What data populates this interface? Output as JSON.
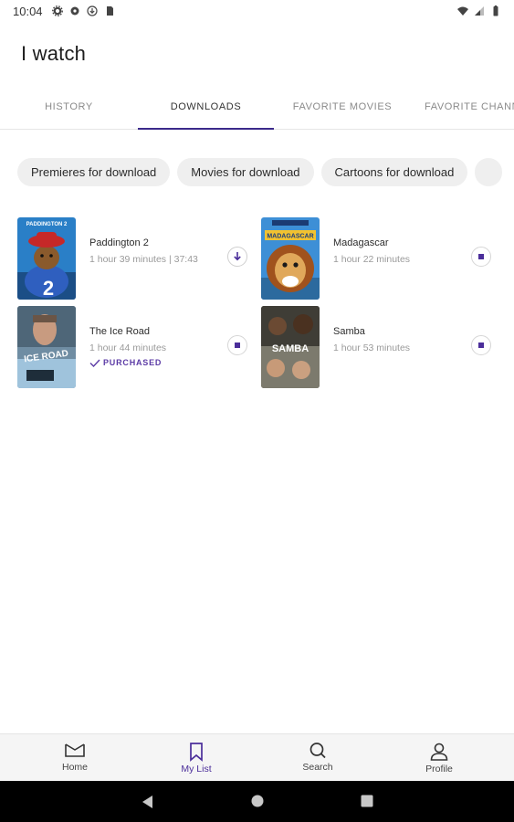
{
  "status_bar": {
    "time": "10:04",
    "left_icons": [
      "gear-icon",
      "notification-icon",
      "download-status-icon",
      "sd-card-icon"
    ],
    "right_icons": [
      "wifi-icon",
      "signal-icon",
      "battery-icon"
    ]
  },
  "app": {
    "title": "I watch"
  },
  "tabs": [
    {
      "label": "HISTORY",
      "active": false
    },
    {
      "label": "DOWNLOADS",
      "active": true
    },
    {
      "label": "FAVORITE MOVIES",
      "active": false
    },
    {
      "label": "FAVORITE CHANN",
      "active": false
    }
  ],
  "chips": [
    {
      "label": "Premieres for download"
    },
    {
      "label": "Movies for download"
    },
    {
      "label": "Cartoons for download"
    },
    {
      "label": ""
    }
  ],
  "movies": [
    {
      "title": "Paddington 2",
      "meta": "1 hour 39 minutes | 37:43",
      "badge": "",
      "action": "downloading",
      "poster_text": "PADDINGTON 2"
    },
    {
      "title": "Madagascar",
      "meta": "1 hour 22 minutes",
      "badge": "",
      "action": "stop",
      "poster_text": "MADAGASCAR"
    },
    {
      "title": "The Ice Road",
      "meta": "1 hour 44 minutes",
      "badge": "PURCHASED",
      "action": "stop",
      "poster_text": "ICE ROAD"
    },
    {
      "title": "Samba",
      "meta": "1 hour 53 minutes",
      "badge": "",
      "action": "stop",
      "poster_text": "SAMBA"
    }
  ],
  "bottom_nav": [
    {
      "label": "Home",
      "icon": "home-icon",
      "active": false
    },
    {
      "label": "My List",
      "icon": "bookmark-icon",
      "active": true
    },
    {
      "label": "Search",
      "icon": "search-icon",
      "active": false
    },
    {
      "label": "Profile",
      "icon": "profile-icon",
      "active": false
    }
  ],
  "colors": {
    "accent": "#4b2e9a",
    "tab_indicator": "#3b2a8a",
    "chip_bg": "#efefef"
  }
}
